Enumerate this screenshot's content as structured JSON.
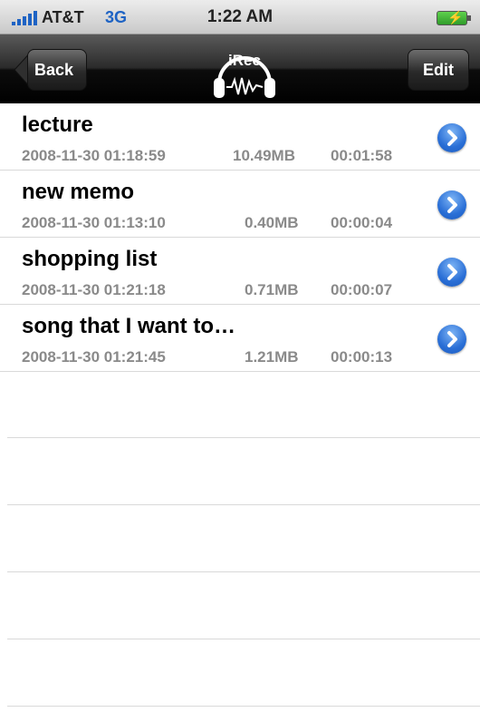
{
  "status_bar": {
    "carrier": "AT&T",
    "network": "3G",
    "time": "1:22 AM"
  },
  "nav": {
    "back_label": "Back",
    "logo_text": "iRec",
    "edit_label": "Edit"
  },
  "recordings": [
    {
      "title": "lecture",
      "date": "2008-11-30 01:18:59",
      "size": "10.49MB",
      "duration": "00:01:58"
    },
    {
      "title": "new memo",
      "date": "2008-11-30 01:13:10",
      "size": "0.40MB",
      "duration": "00:00:04"
    },
    {
      "title": "shopping list",
      "date": "2008-11-30 01:21:18",
      "size": "0.71MB",
      "duration": "00:00:07"
    },
    {
      "title": "song that I want to…",
      "date": "2008-11-30 01:21:45",
      "size": "1.21MB",
      "duration": "00:00:13"
    }
  ],
  "colors": {
    "accent": "#1e63c4",
    "meta_text": "#8a8a8a"
  }
}
